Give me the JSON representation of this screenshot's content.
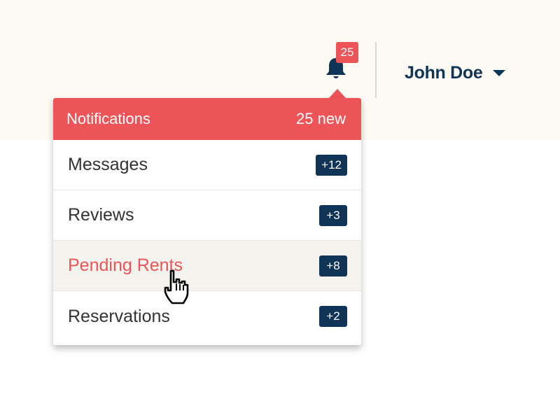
{
  "header": {
    "notification_count": "25",
    "user_name": "John Doe",
    "bell_icon": "bell-icon",
    "caret_icon": "caret-down-icon"
  },
  "dropdown": {
    "title": "Notifications",
    "new_count": "25 new",
    "items": [
      {
        "label": "Messages",
        "count": "+12"
      },
      {
        "label": "Reviews",
        "count": "+3"
      },
      {
        "label": "Pending Rents",
        "count": "+8"
      },
      {
        "label": "Reservations",
        "count": "+2"
      }
    ]
  },
  "colors": {
    "accent_red": "#ec5457",
    "navy": "#0f3455",
    "header_bg": "#fdfaf4",
    "hover_bg": "#f5f3ee"
  }
}
